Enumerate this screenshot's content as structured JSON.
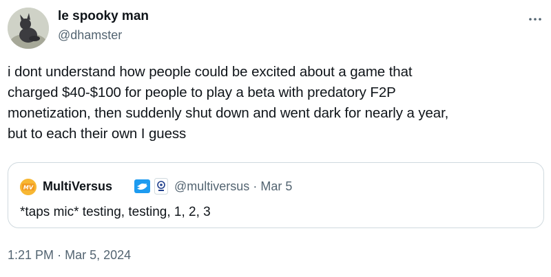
{
  "author": {
    "display_name": "le spooky man",
    "handle": "@dhamster"
  },
  "tweet": {
    "text_lines": [
      "i dont understand how people could be excited about a game that",
      "charged $40-$100 for people to play a beta with predatory F2P",
      "monetization, then suddenly shut down and went dark for nearly a year,",
      "but to each their own I guess"
    ],
    "time": "1:21 PM",
    "separator": "·",
    "date": "Mar 5, 2024"
  },
  "quoted_tweet": {
    "display_name": "MultiVersus",
    "handle": "@multiversus",
    "separator": "·",
    "date": "Mar 5",
    "text": "*taps mic* testing, testing, 1, 2, 3",
    "avatar_text": "MV"
  },
  "icons": {
    "more": "more-horizontal-icon",
    "verified": "verified-badge-icon",
    "affiliate": "affiliate-badge-icon"
  },
  "colors": {
    "text_primary": "#0f1419",
    "text_secondary": "#536471",
    "verified_blue": "#1d9bf0",
    "border": "#cfd9de",
    "quote_avatar": "#f7b733"
  }
}
